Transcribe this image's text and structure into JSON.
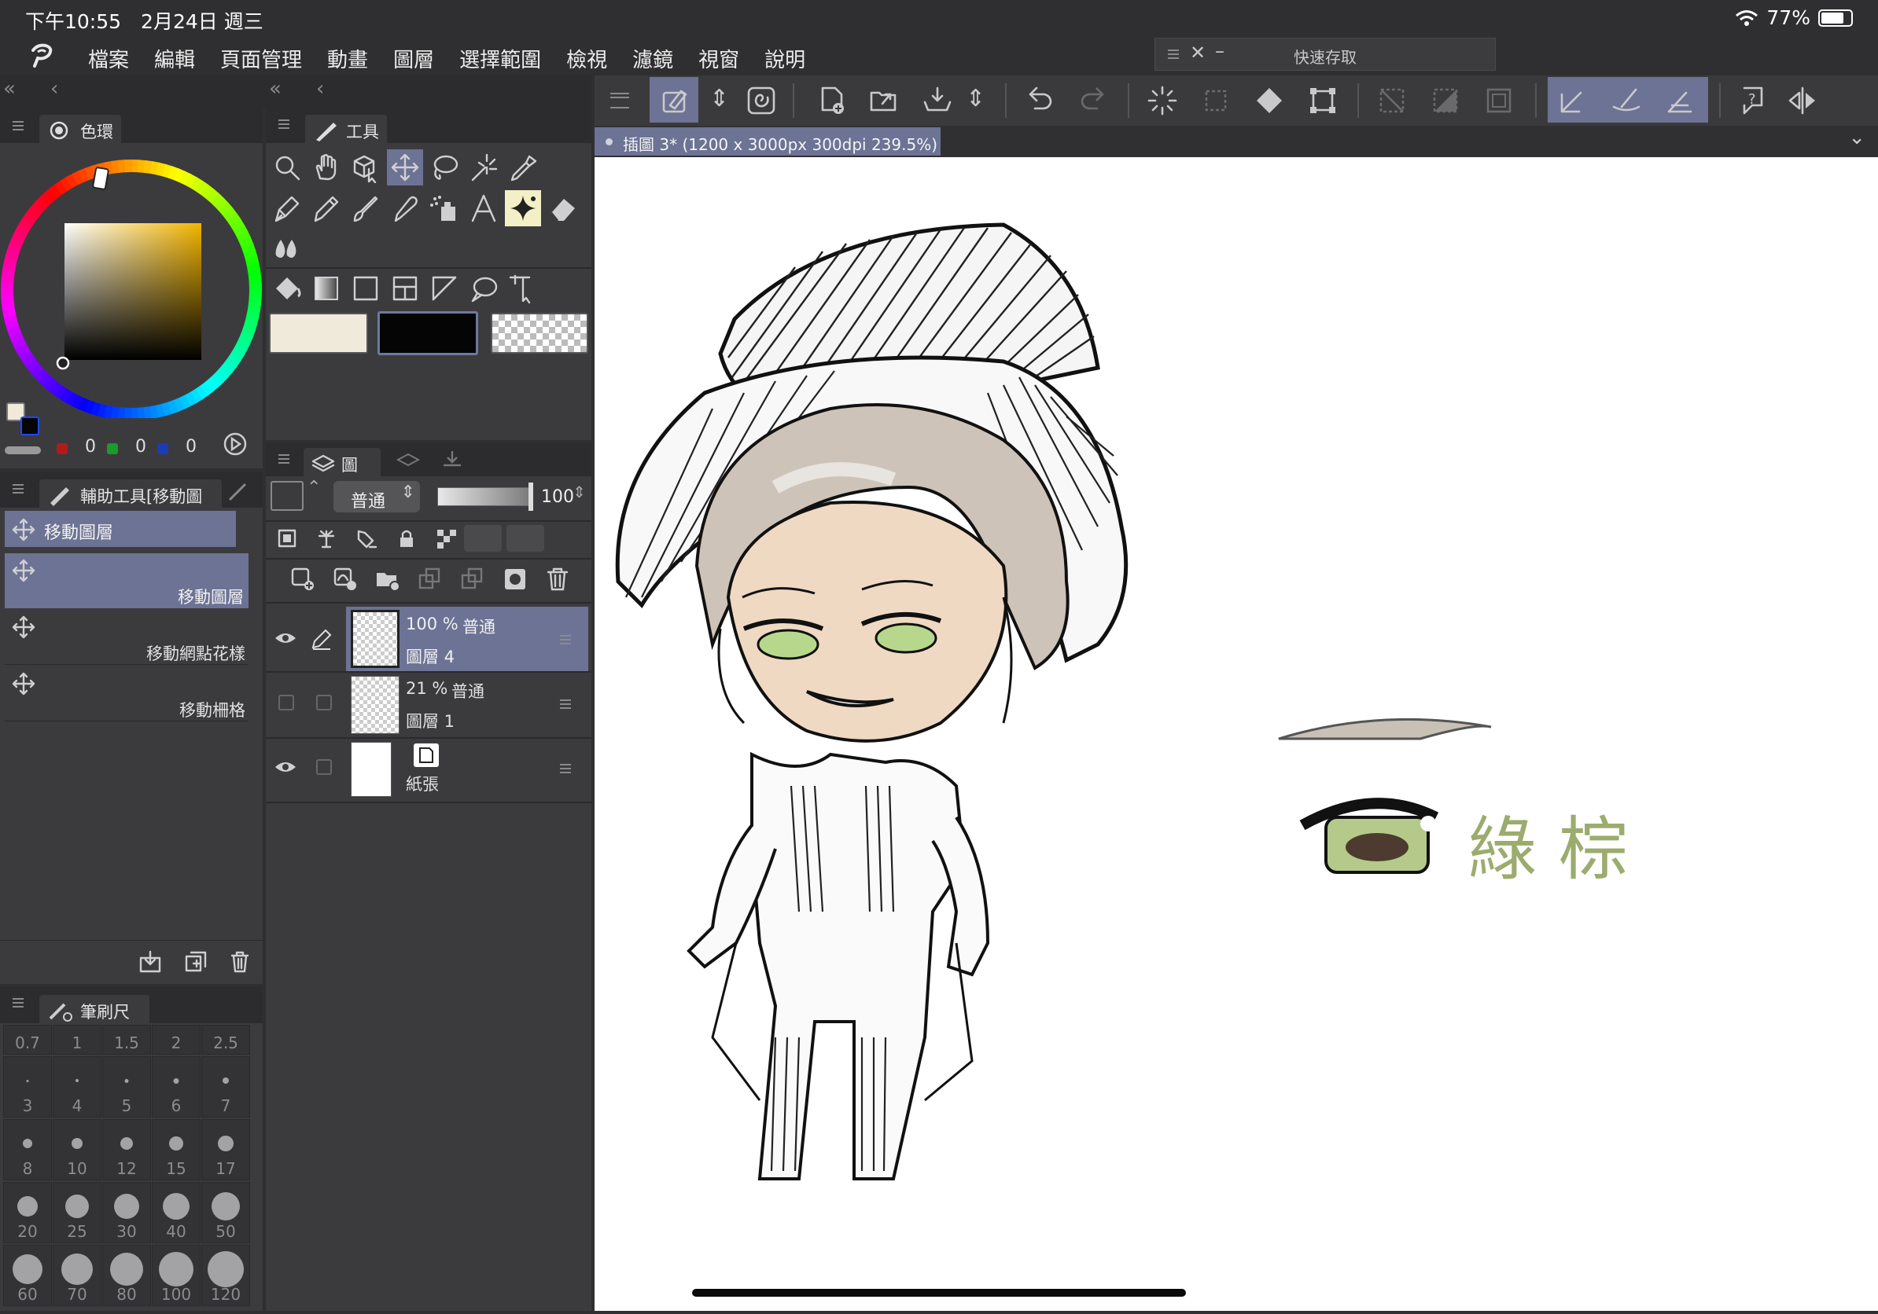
{
  "status_bar": {
    "time": "下午10:55　2月24日 週三",
    "battery": "77%"
  },
  "menu": {
    "items": [
      "檔案",
      "編輯",
      "頁面管理",
      "動畫",
      "圖層",
      "選擇範圍",
      "檢視",
      "濾鏡",
      "視窗",
      "說明"
    ]
  },
  "quick_save": {
    "title": "快速存取"
  },
  "color_panel": {
    "tab": "色環",
    "r": "0",
    "g": "0",
    "b": "0"
  },
  "tool_panel": {
    "tab": "工具"
  },
  "sub_tool_panel": {
    "tab": "輔助工具[移動圖",
    "group": "移動圖層",
    "items": [
      "移動圖層",
      "移動網點花樣",
      "移動柵格"
    ]
  },
  "brush_size_panel": {
    "tab": "筆刷尺寸",
    "sizes": [
      "0.7",
      "1",
      "1.5",
      "2",
      "2.5",
      "3",
      "4",
      "5",
      "6",
      "7",
      "8",
      "10",
      "12",
      "15",
      "17",
      "20",
      "25",
      "30",
      "40",
      "50",
      "60",
      "70",
      "80",
      "100",
      "120"
    ]
  },
  "layer_panel": {
    "tab": "圖層",
    "blend_mode": "普通",
    "opacity": "100",
    "layers": [
      {
        "opacity": "100 %",
        "mode": "普通",
        "name": "圖層 4"
      },
      {
        "opacity": "21 %",
        "mode": "普通",
        "name": "圖層 1"
      },
      {
        "opacity": "",
        "mode": "",
        "name": "紙張"
      }
    ]
  },
  "canvas": {
    "tab_title": "插圖 3* (1200 x 3000px 300dpi 239.5%)",
    "note_text": "綠 棕"
  },
  "colors": {
    "main_color": "#efead9",
    "sub_color": "#050505",
    "selected_accent": "#6c7394"
  }
}
